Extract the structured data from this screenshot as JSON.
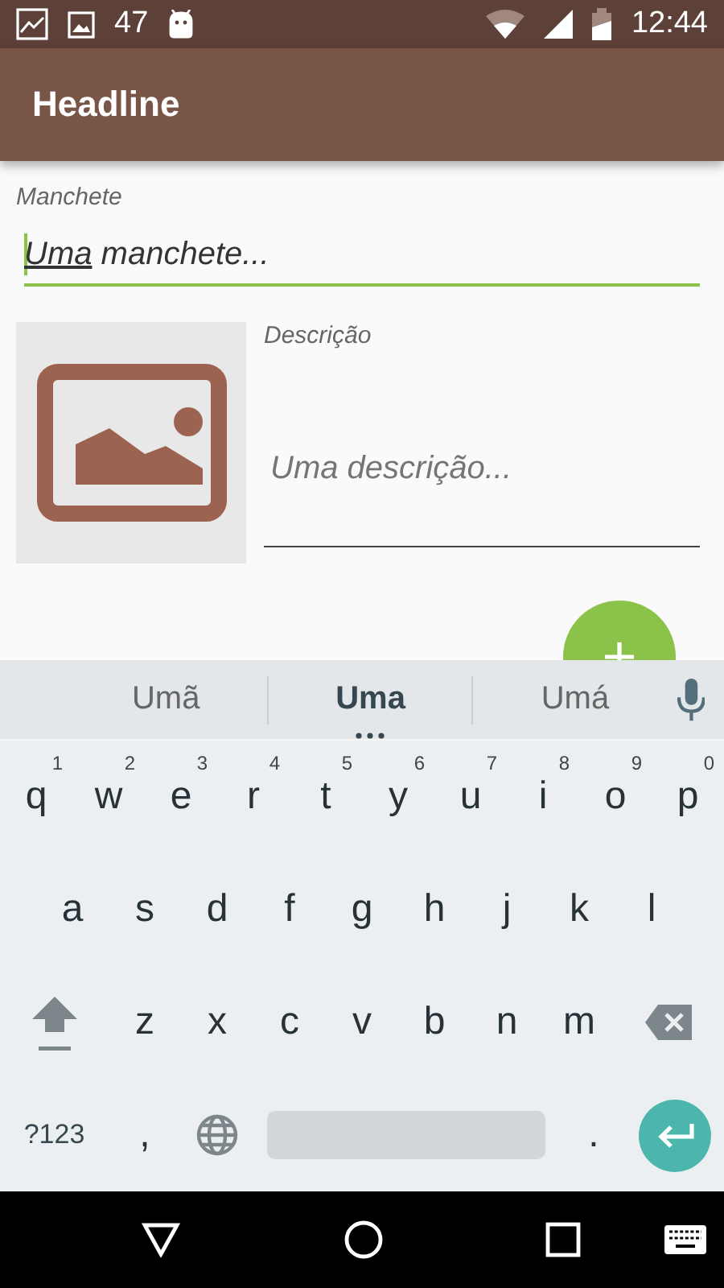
{
  "status_bar": {
    "notification_count": "47",
    "time": "12:44"
  },
  "app_bar": {
    "title": "Headline"
  },
  "form": {
    "headline": {
      "label": "Manchete",
      "focused": true,
      "value_parts": [
        {
          "text": "Uma",
          "composing": true
        },
        {
          "text": " manchete...",
          "composing": false
        }
      ]
    },
    "description": {
      "label": "Descrição",
      "placeholder": "Uma descrição...",
      "focused": false
    }
  },
  "keyboard": {
    "suggestions": [
      {
        "text": "Umã",
        "selected": false
      },
      {
        "text": "Uma",
        "selected": true
      },
      {
        "text": "Umá",
        "selected": false
      }
    ],
    "rows": [
      [
        {
          "kind": "letter",
          "label": "q",
          "hint": "1"
        },
        {
          "kind": "letter",
          "label": "w",
          "hint": "2"
        },
        {
          "kind": "letter",
          "label": "e",
          "hint": "3"
        },
        {
          "kind": "letter",
          "label": "r",
          "hint": "4"
        },
        {
          "kind": "letter",
          "label": "t",
          "hint": "5"
        },
        {
          "kind": "letter",
          "label": "y",
          "hint": "6"
        },
        {
          "kind": "letter",
          "label": "u",
          "hint": "7"
        },
        {
          "kind": "letter",
          "label": "i",
          "hint": "8"
        },
        {
          "kind": "letter",
          "label": "o",
          "hint": "9"
        },
        {
          "kind": "letter",
          "label": "p",
          "hint": "0"
        }
      ],
      [
        {
          "kind": "letter",
          "label": "a"
        },
        {
          "kind": "letter",
          "label": "s"
        },
        {
          "kind": "letter",
          "label": "d"
        },
        {
          "kind": "letter",
          "label": "f"
        },
        {
          "kind": "letter",
          "label": "g"
        },
        {
          "kind": "letter",
          "label": "h"
        },
        {
          "kind": "letter",
          "label": "j"
        },
        {
          "kind": "letter",
          "label": "k"
        },
        {
          "kind": "letter",
          "label": "l"
        }
      ],
      [
        {
          "kind": "shift"
        },
        {
          "kind": "letter",
          "label": "z"
        },
        {
          "kind": "letter",
          "label": "x"
        },
        {
          "kind": "letter",
          "label": "c"
        },
        {
          "kind": "letter",
          "label": "v"
        },
        {
          "kind": "letter",
          "label": "b"
        },
        {
          "kind": "letter",
          "label": "n"
        },
        {
          "kind": "letter",
          "label": "m"
        },
        {
          "kind": "backspace"
        }
      ],
      [
        {
          "kind": "symbols",
          "label": "?123"
        },
        {
          "kind": "letter",
          "label": ","
        },
        {
          "kind": "globe"
        },
        {
          "kind": "space"
        },
        {
          "kind": "letter",
          "label": "."
        },
        {
          "kind": "enter"
        }
      ]
    ]
  }
}
